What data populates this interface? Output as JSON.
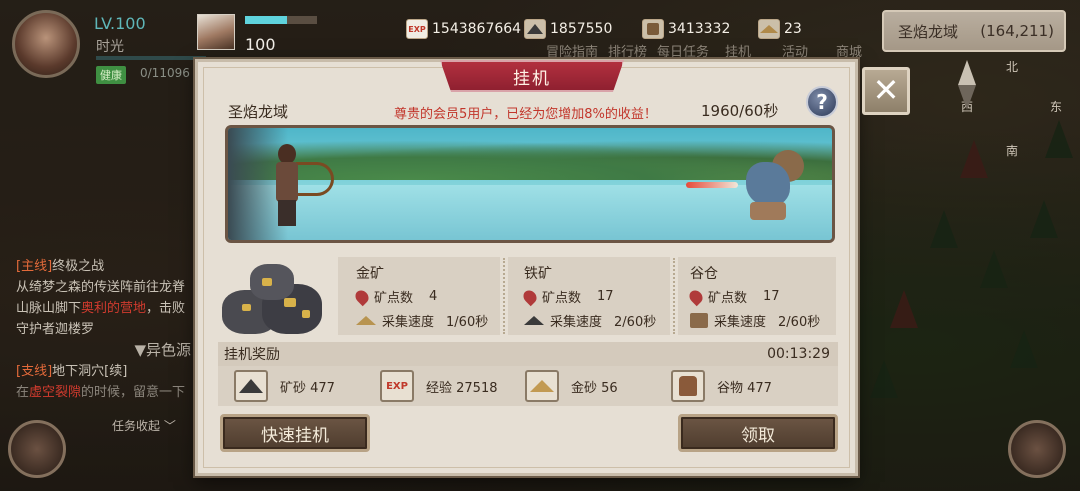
{
  "player": {
    "level": "LV.100",
    "name": "时光",
    "status_badge": "健康",
    "status_value": "0/11096"
  },
  "hero": {
    "power": "100",
    "hp_fraction": 0.58
  },
  "resources": [
    {
      "icon": "exp-icon",
      "value": "1543867664"
    },
    {
      "icon": "ore-icon",
      "value": "1857550"
    },
    {
      "icon": "grain-icon",
      "value": "3413332"
    },
    {
      "icon": "gold-sand-icon",
      "value": "23"
    }
  ],
  "top_menu": [
    "冒险指南",
    "排行榜",
    "每日任务",
    "挂机",
    "活动",
    "商城"
  ],
  "location": {
    "name": "圣焰龙域",
    "coords": "(164,211)"
  },
  "compass": {
    "north": "北",
    "west": "西",
    "east": "东",
    "south": "南"
  },
  "quests": {
    "main_tag": "[主线]",
    "main_title": "终极之战",
    "main_text_1": "从绮梦之森的传送阵前往龙脊山脉山脚下",
    "main_text_red": "奥利的营地",
    "main_text_2": "，击败守护者迦楼罗",
    "section": "▼异色源",
    "side_tag": "[支线]",
    "side_title": "地下洞穴[续]",
    "side_text_1": "在",
    "side_text_red": "虚空裂隙",
    "side_text_2": "的时候，留意一下所谓的线",
    "collapse_label": "任务收起"
  },
  "modal": {
    "title": "挂机",
    "region": "圣焰龙域",
    "vip_notice": "尊贵的会员5用户，已经为您增加8%的收益！",
    "rate": "1960/60秒",
    "help": "?",
    "close": "✕",
    "mines": [
      {
        "name": "金矿",
        "points_label": "矿点数",
        "points": "4",
        "speed_label": "采集速度",
        "speed": "1/60秒",
        "icon": "gold-sand-icon"
      },
      {
        "name": "铁矿",
        "points_label": "矿点数",
        "points": "17",
        "speed_label": "采集速度",
        "speed": "2/60秒",
        "icon": "ore-icon"
      },
      {
        "name": "谷仓",
        "points_label": "矿点数",
        "points": "17",
        "speed_label": "采集速度",
        "speed": "2/60秒",
        "icon": "grain-icon"
      }
    ],
    "reward_label": "挂机奖励",
    "reward_timer": "00:13:29",
    "rewards": [
      {
        "icon": "ore-icon",
        "label": "矿砂 477"
      },
      {
        "icon": "exp-icon",
        "label": "经验 27518"
      },
      {
        "icon": "gold-sand-icon",
        "label": "金砂 56"
      },
      {
        "icon": "grain-icon",
        "label": "谷物 477"
      }
    ],
    "quick_button": "快速挂机",
    "claim_button": "领取",
    "exp_icon_text": "EXP"
  }
}
